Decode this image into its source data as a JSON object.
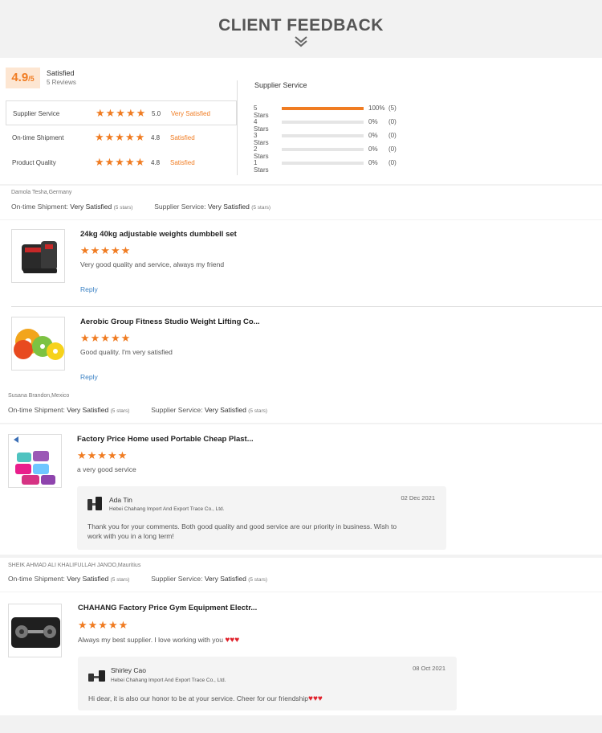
{
  "header": {
    "title": "CLIENT FEEDBACK"
  },
  "summary": {
    "score": "4.9",
    "score_out_of": "/5",
    "satisfaction": "Satisfied",
    "reviews": "5 Reviews",
    "dimensions": [
      {
        "label": "Supplier Service",
        "score": "5.0",
        "rating": "Very Satisfied"
      },
      {
        "label": "On-time Shipment",
        "score": "4.8",
        "rating": "Satisfied"
      },
      {
        "label": "Product Quality",
        "score": "4.8",
        "rating": "Satisfied"
      }
    ],
    "supplier_service_title": "Supplier Service",
    "bars": [
      {
        "label": "5  Stars",
        "fill": 1.0,
        "pct": "100%",
        "count": "(5)"
      },
      {
        "label": "4  Stars",
        "fill": 0,
        "pct": "0%",
        "count": "(0)"
      },
      {
        "label": "3  Stars",
        "fill": 0,
        "pct": "0%",
        "count": "(0)"
      },
      {
        "label": "2  Stars",
        "fill": 0,
        "pct": "0%",
        "count": "(0)"
      },
      {
        "label": "1  Stars",
        "fill": 0,
        "pct": "0%",
        "count": "(0)"
      }
    ]
  },
  "stars_glyph": "★★★★★",
  "groups": [
    {
      "reviewer": "Damola Tesha,Germany",
      "shipment_label": "On-time Shipment:",
      "shipment_value": "Very Satisfied",
      "shipment_stars": "(5 stars)",
      "service_label": "Supplier Service:",
      "service_value": "Very Satisfied",
      "service_stars": "(5 stars)",
      "reviews": [
        {
          "title": "24kg 40kg adjustable weights dumbbell set",
          "text": "Very good quality and service, always my friend",
          "reply": "Reply"
        },
        {
          "title": "Aerobic Group Fitness Studio Weight Lifting Co...",
          "text": "Good quality. I'm very satisfied",
          "reply": "Reply"
        }
      ]
    },
    {
      "reviewer": "Susana Brandon,Mexico",
      "shipment_label": "On-time Shipment:",
      "shipment_value": "Very Satisfied",
      "shipment_stars": "(5 stars)",
      "service_label": "Supplier Service:",
      "service_value": "Very Satisfied",
      "service_stars": "(5 stars)",
      "reviews": [
        {
          "title": "Factory Price Home used Portable Cheap Plast...",
          "text": "a very good service",
          "response": {
            "name": "Ada Tin",
            "company": "Hebei Chahang Import And Export Trace Co., Ltd.",
            "date": "02 Dec 2021",
            "message_line1": "Thank you for your comments. Both good quality and good service are our priority in business. Wish to",
            "message_line2": "work with you in a long term!"
          }
        }
      ]
    },
    {
      "reviewer": "SHEIK AHMAD ALI KHALIFULLAH JANOO,Mauritius",
      "shipment_label": "On-time Shipment:",
      "shipment_value": "Very Satisfied",
      "shipment_stars": "(5 stars)",
      "service_label": "Supplier Service:",
      "service_value": "Very Satisfied",
      "service_stars": "(5 stars)",
      "reviews": [
        {
          "title": "CHAHANG Factory Price Gym Equipment Electr...",
          "text": "Always my best supplier. I love working with you",
          "text_hearts": "♥♥♥",
          "response": {
            "name": "Shirley Cao",
            "company": "Hebei Chahang Import And Export Trace Co., Ltd.",
            "date": "08 Oct 2021",
            "message_line1": "Hi dear, it is also our honor to be at your service. Cheer for our friendship",
            "hearts": "♥♥♥"
          }
        }
      ]
    }
  ],
  "colors": {
    "accent": "#f07c22",
    "link": "#3b82c4",
    "heart": "#e0202a"
  }
}
